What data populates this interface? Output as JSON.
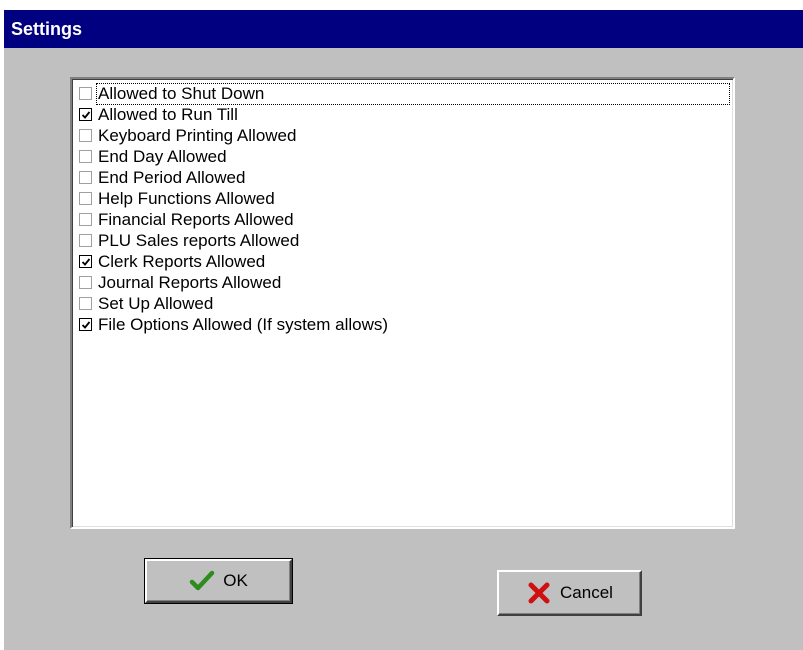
{
  "window": {
    "title": "Settings"
  },
  "permissions": {
    "items": [
      {
        "label": "Allowed to Shut Down",
        "checked": false,
        "focused": true
      },
      {
        "label": "Allowed to Run Till",
        "checked": true
      },
      {
        "label": "Keyboard Printing Allowed",
        "checked": false
      },
      {
        "label": "End Day Allowed",
        "checked": false
      },
      {
        "label": "End Period Allowed",
        "checked": false
      },
      {
        "label": "Help Functions Allowed",
        "checked": false
      },
      {
        "label": "Financial Reports Allowed",
        "checked": false
      },
      {
        "label": "PLU Sales reports Allowed",
        "checked": false
      },
      {
        "label": "Clerk Reports Allowed",
        "checked": true
      },
      {
        "label": "Journal Reports Allowed",
        "checked": false
      },
      {
        "label": "Set Up Allowed",
        "checked": false
      },
      {
        "label": "File Options Allowed (If system allows)",
        "checked": true
      }
    ]
  },
  "buttons": {
    "ok_label": "OK",
    "ok_icon": "green-checkmark-icon",
    "cancel_label": "Cancel",
    "cancel_icon": "red-x-icon"
  },
  "colors": {
    "titlebar": "#000080",
    "face": "#c0c0c0",
    "ok_icon": "#2e8b1e",
    "cancel_icon": "#d01010"
  }
}
